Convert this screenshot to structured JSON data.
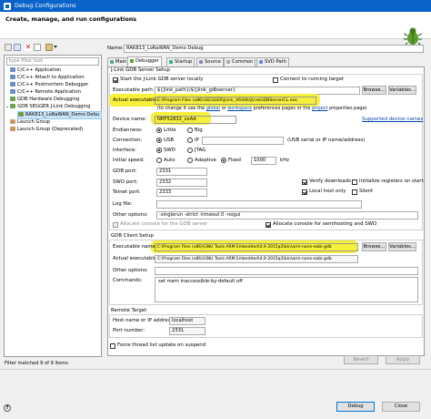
{
  "window": {
    "title": "Debug Configurations"
  },
  "header": {
    "title": "Create, manage, and run configurations"
  },
  "sidebar": {
    "filter_placeholder": "type filter text",
    "items": [
      {
        "label": "C/C++ Application"
      },
      {
        "label": "C/C++ Attach to Application"
      },
      {
        "label": "C/C++ Postmortem Debugger"
      },
      {
        "label": "C/C++ Remote Application"
      },
      {
        "label": "GDB Hardware Debugging"
      },
      {
        "label": "GDB SEGGER J-Link Debugging"
      },
      {
        "label": "RAK813_LoRaWAN_Demo Debu"
      },
      {
        "label": "Launch Group"
      },
      {
        "label": "Launch Group (Deprecated)"
      }
    ],
    "status": "Filter matched 9 of 9 items"
  },
  "config": {
    "name_label": "Name:",
    "name_value": "RAK813_LoRaWAN_Demo Debug",
    "tabs": [
      {
        "label": "Main"
      },
      {
        "label": "Debugger"
      },
      {
        "label": "Startup"
      },
      {
        "label": "Source"
      },
      {
        "label": "Common"
      },
      {
        "label": "SVD Path"
      }
    ]
  },
  "jlink": {
    "group_title": "J-Link GDB Server Setup",
    "start_locally": "Start the J-Link GDB server locally",
    "connect_running": "Connect to running target",
    "exec_path_label": "Executable path:",
    "exec_path_value": "${jlink_path}/${jlink_gdbserver}",
    "browse": "Browse...",
    "variables": "Variables...",
    "actual_exec_label": "Actual executable:",
    "actual_exec_value": "C:\\Program Files (x86)\\SEGGER\\JLink_V644b\\JLinkGDBServerCL.exe",
    "change_note_prefix": "(to change it use the",
    "global_link": "global",
    "or_text": "or",
    "workspace_link": "workspace",
    "pref_text": "preferences pages or the",
    "project_link": "project",
    "props_text": "properties page)",
    "device_label": "Device name:",
    "device_value": "NRF52832_xxAA",
    "supported_devices": "Supported device names",
    "endianness_label": "Endianness:",
    "little": "Little",
    "big": "Big",
    "connection_label": "Connection:",
    "usb": "USB",
    "ip": "IP",
    "usb_hint": "(USB serial or IP name/address)",
    "interface_label": "Interface:",
    "swd": "SWD",
    "jtag": "JTAG",
    "speed_label": "Initial speed:",
    "auto": "Auto",
    "adaptive": "Adaptive",
    "fixed": "Fixed",
    "speed_value": "1000",
    "khz": "kHz",
    "gdb_port_label": "GDB port:",
    "gdb_port": "2331",
    "swo_port_label": "SWO port:",
    "swo_port": "2332",
    "telnet_port_label": "Telnet port:",
    "telnet_port": "2333",
    "verify_downloads": "Verify downloads",
    "init_registers": "Initialize registers on start",
    "local_host_only": "Local host only",
    "silent": "Silent",
    "log_file_label": "Log file:",
    "other_options_label": "Other options:",
    "other_options_value": "-singlerun -strict -timeout 0 -nogui",
    "allocate_console_gdb": "Allocate console for the GDB server",
    "allocate_console_semi": "Allocate console for semihosting and SWO"
  },
  "gdbclient": {
    "group_title": "GDB Client Setup",
    "exec_name_label": "Executable name:",
    "exec_name_value": "C:\\Program Files (x86)\\GNU Tools ARM Embedded\\4.9 2015q3\\bin\\arm-none-eabi-gdb",
    "actual_exec_label": "Actual executable:",
    "actual_exec_value": "C:\\Program Files (x86)\\GNU Tools ARM Embedded\\4.9 2015q3\\bin\\arm-none-eabi-gdb",
    "other_options_label": "Other options:",
    "commands_label": "Commands:",
    "commands_value": "set mem inaccessible-by-default off"
  },
  "remote": {
    "group_title": "Remote Target",
    "host_label": "Host name or IP address:",
    "host_value": "localhost",
    "port_label": "Port number:",
    "port_value": "2331"
  },
  "force_thread": "Force thread list update on suspend",
  "buttons": {
    "revert": "Revert",
    "apply": "Apply",
    "debug": "Debug",
    "close": "Close"
  },
  "colors": {
    "highlight": "#f7f03a",
    "titlebar": "#0a63c9"
  }
}
